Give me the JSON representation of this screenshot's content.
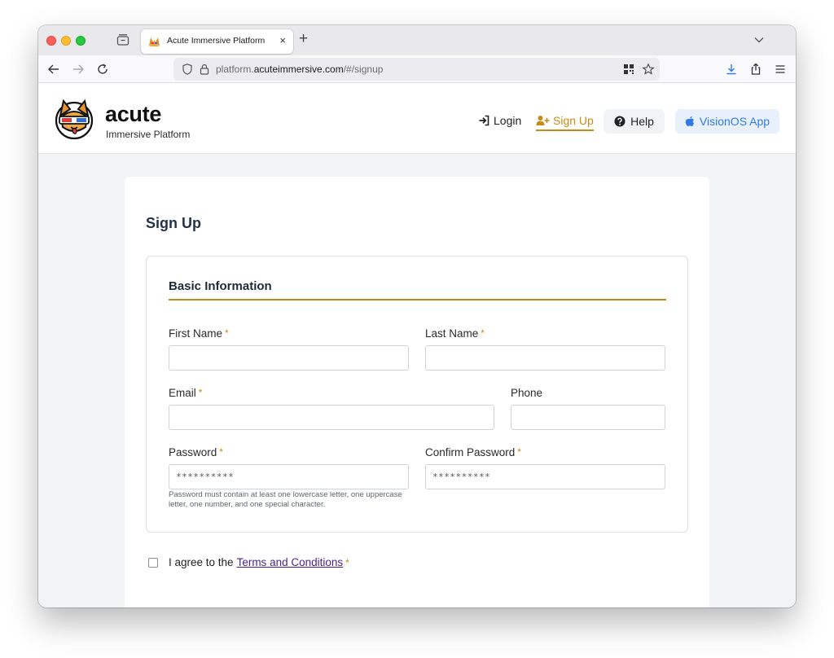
{
  "browser": {
    "tab_title": "Acute Immersive Platform",
    "tab_close": "×",
    "new_tab": "+",
    "url_prefix": "platform.",
    "url_domain": "acuteimmersive.com",
    "url_path": "/#/signup"
  },
  "header": {
    "logo_word": "acute",
    "logo_sub": "Immersive Platform",
    "nav": {
      "login": "Login",
      "signup": "Sign Up",
      "help": "Help",
      "visionos": "VisionOS App"
    }
  },
  "form": {
    "title": "Sign Up",
    "section_title": "Basic Information",
    "required_mark": "*",
    "first_name_label": "First Name",
    "last_name_label": "Last Name",
    "email_label": "Email",
    "phone_label": "Phone",
    "password_label": "Password",
    "confirm_password_label": "Confirm Password",
    "first_name_value": "",
    "last_name_value": "",
    "email_value": "",
    "phone_value": "",
    "password_value": "**********",
    "confirm_password_value": "**********",
    "password_hint": "Password must contain at least one lowercase letter, one uppercase letter, one number, and one special character.",
    "agree_text": "I agree to the",
    "terms_link": "Terms and Conditions"
  },
  "colors": {
    "accent": "#c98a16",
    "link": "#4a1f86",
    "vision_blue": "#2f7ae5",
    "heading": "#23344a"
  },
  "icons": [
    "tab-overview-icon",
    "back-arrow-icon",
    "forward-arrow-icon",
    "reload-icon",
    "shield-icon",
    "lock-icon",
    "qr-code-icon",
    "star-icon",
    "download-icon",
    "share-icon",
    "menu-icon",
    "login-icon",
    "add-user-icon",
    "question-icon",
    "apple-icon"
  ]
}
